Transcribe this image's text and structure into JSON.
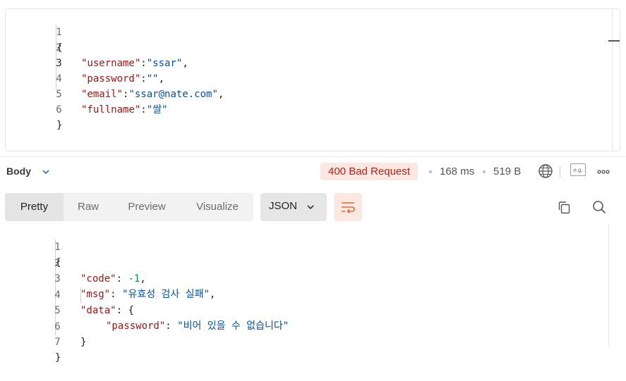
{
  "request_editor": {
    "lines": [
      {
        "num": "1",
        "text": "{"
      },
      {
        "num": "2",
        "key": "\"username\"",
        "sep": ":",
        "val": "\"ssar\"",
        "end": ","
      },
      {
        "num": "3",
        "key": "\"password\"",
        "sep": ":",
        "val": "\"\"",
        "end": ","
      },
      {
        "num": "4",
        "key": "\"email\"",
        "sep": ":",
        "val": "\"ssar@nate.com\"",
        "end": ","
      },
      {
        "num": "5",
        "key": "\"fullname\"",
        "sep": ":",
        "val": "\"쌀\"",
        "end": ""
      },
      {
        "num": "6",
        "text": "}"
      }
    ]
  },
  "response_bar": {
    "body_label": "Body",
    "status": "400 Bad Request",
    "time": "168 ms",
    "size": "519 B",
    "eg_label": "e.g."
  },
  "toolbar": {
    "tabs": [
      "Pretty",
      "Raw",
      "Preview",
      "Visualize"
    ],
    "format": "JSON"
  },
  "response_editor": {
    "lines": [
      {
        "num": "1",
        "text": "{"
      },
      {
        "num": "2",
        "key": "\"code\"",
        "sep": ": ",
        "val": "-1",
        "end": ","
      },
      {
        "num": "3",
        "key": "\"msg\"",
        "sep": ": ",
        "val": "\"유효성 검사 실패\"",
        "end": ","
      },
      {
        "num": "4",
        "key": "\"data\"",
        "sep": ": ",
        "val": "{",
        "end": ""
      },
      {
        "num": "5",
        "key": "\"password\"",
        "sep": ": ",
        "val": "\"비어 있을 수 없습니다\"",
        "end": ""
      },
      {
        "num": "6",
        "text": "}"
      },
      {
        "num": "7",
        "text": "}"
      }
    ]
  },
  "colors": {
    "status_bg": "#fde7e3",
    "status_text": "#b42318",
    "json_key": "#a31515",
    "json_string": "#0451a5",
    "json_number": "#098658",
    "wrap_accent": "#e8663d"
  }
}
